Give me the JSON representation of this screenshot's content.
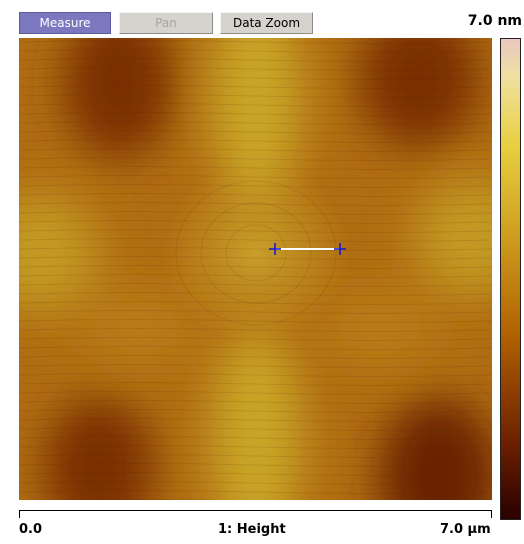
{
  "toolbar": {
    "measure_label": "Measure",
    "pan_label": "Pan",
    "data_zoom_label": "Data Zoom"
  },
  "color_scale": {
    "max_label": "7.0 nm"
  },
  "x_axis": {
    "min_label": "0.0",
    "channel_label": "1: Height",
    "max_label": "7.0 µm"
  },
  "colors": {
    "active_button": "#7b78c0",
    "button_face": "#d6d3ce",
    "measure_line": "#ffffff",
    "cursor_markers": "#1a1acc"
  },
  "icons": {
    "cursor_markers": "crosshair-icon"
  }
}
